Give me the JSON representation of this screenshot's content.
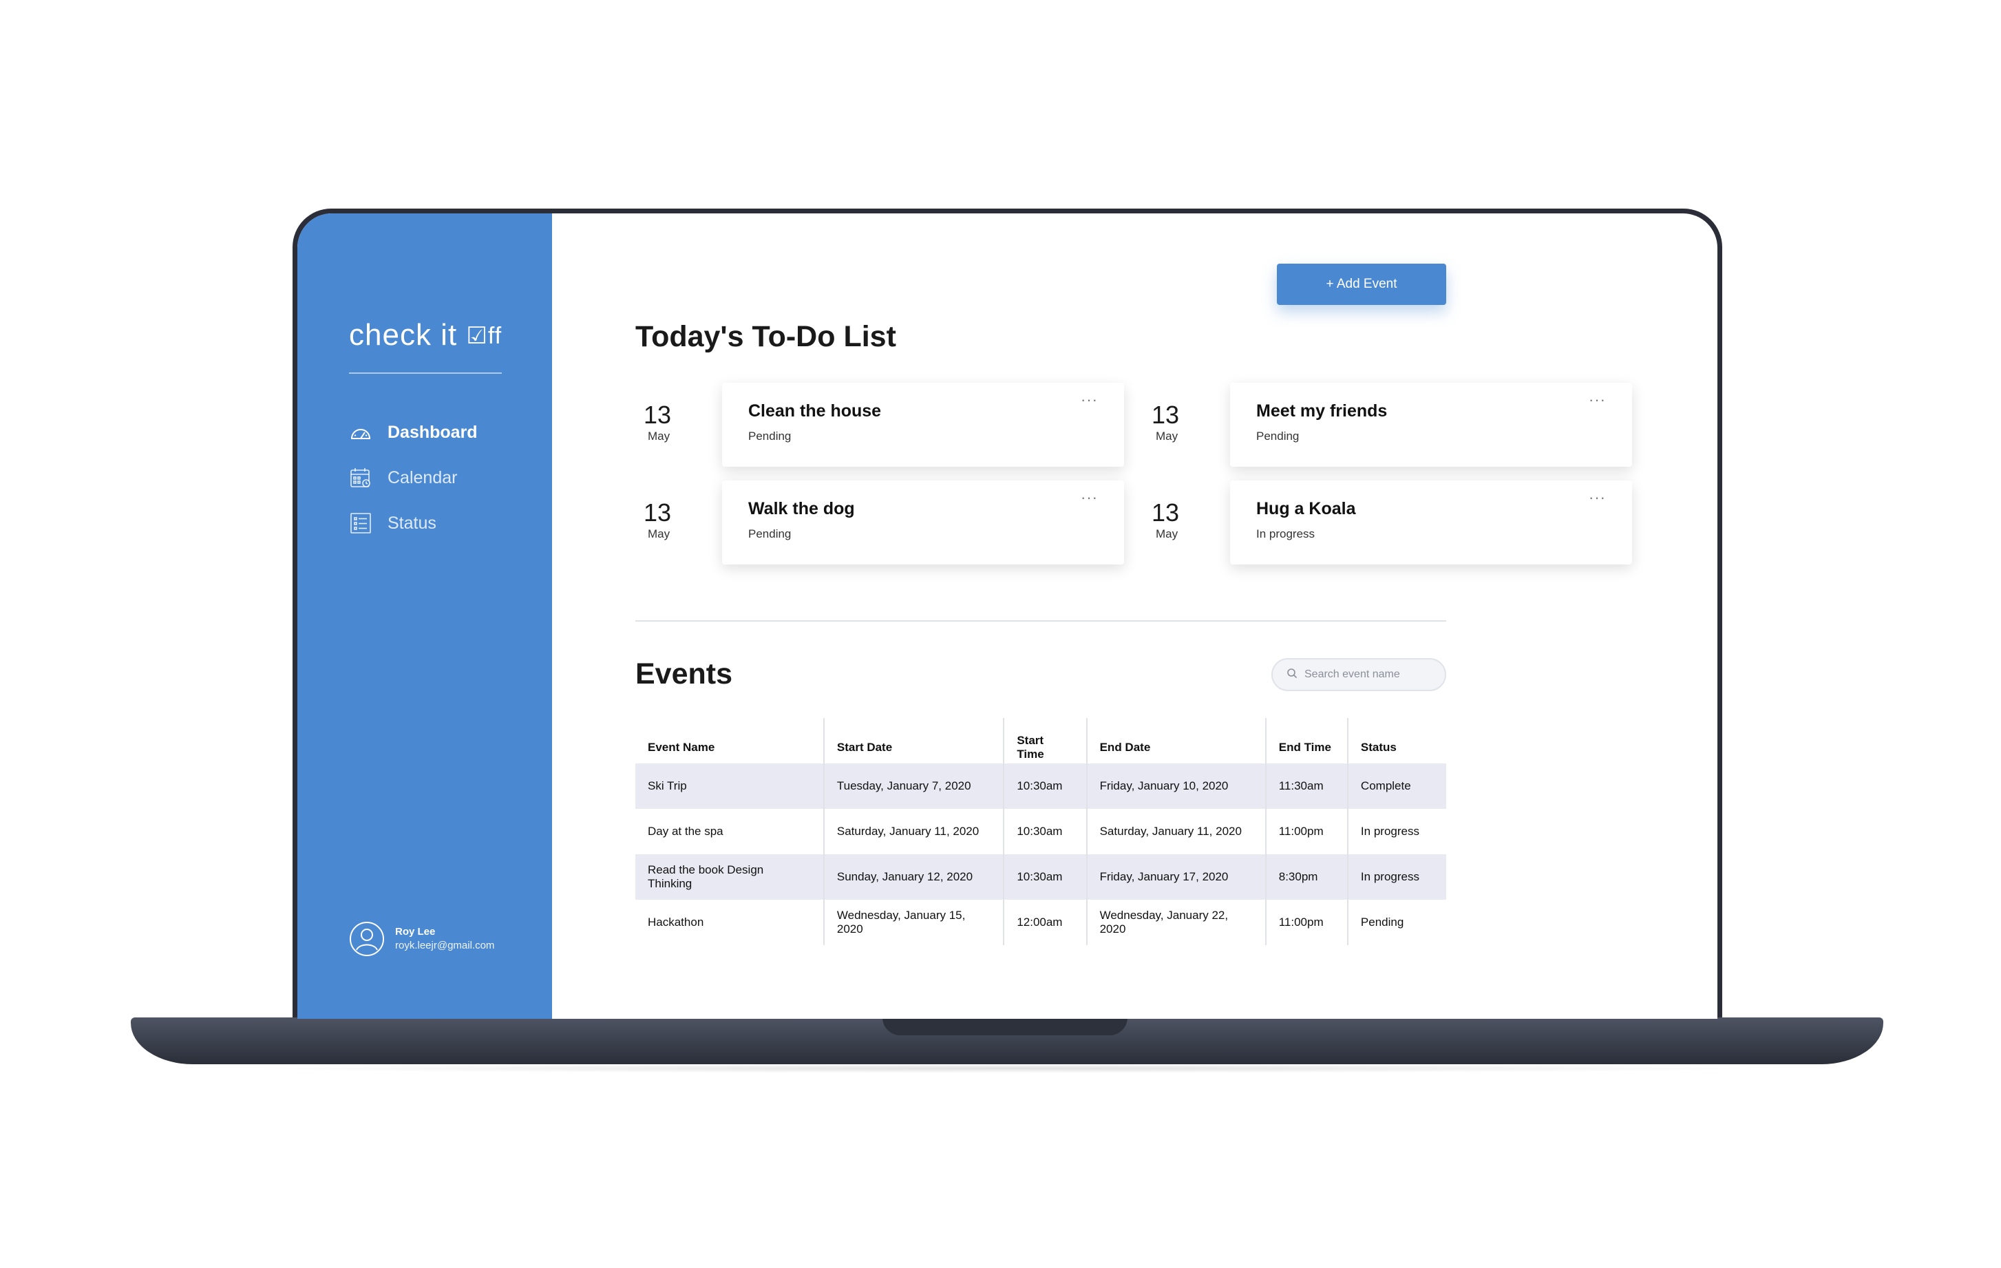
{
  "app": {
    "brand": "check it ",
    "brand_mark": "☑ff"
  },
  "sidebar": {
    "items": [
      {
        "label": "Dashboard",
        "icon": "dashboard-gauge-icon",
        "active": true
      },
      {
        "label": "Calendar",
        "icon": "calendar-icon",
        "active": false
      },
      {
        "label": "Status",
        "icon": "status-list-icon",
        "active": false
      }
    ],
    "user": {
      "name": "Roy Lee",
      "email": "royk.leejr@gmail.com",
      "icon": "user-avatar-icon"
    }
  },
  "header": {
    "add_button": "+ Add Event"
  },
  "todo": {
    "title": "Today's To-Do List",
    "more_label": "···",
    "items": [
      {
        "day": "13",
        "month": "May",
        "title": "Clean the house",
        "status": "Pending"
      },
      {
        "day": "13",
        "month": "May",
        "title": "Meet my friends",
        "status": "Pending"
      },
      {
        "day": "13",
        "month": "May",
        "title": "Walk the dog",
        "status": "Pending"
      },
      {
        "day": "13",
        "month": "May",
        "title": "Hug a Koala",
        "status": "In progress"
      }
    ]
  },
  "events": {
    "title": "Events",
    "search_placeholder": "Search event name",
    "columns": [
      "Event Name",
      "Start Date",
      "Start Time",
      "End Date",
      "End Time",
      "Status"
    ],
    "rows": [
      [
        "Ski Trip",
        "Tuesday, January 7, 2020",
        "10:30am",
        "Friday, January 10, 2020",
        "11:30am",
        "Complete"
      ],
      [
        "Day at the spa",
        "Saturday, January 11, 2020",
        "10:30am",
        "Saturday, January 11, 2020",
        "11:00pm",
        "In progress"
      ],
      [
        "Read the book Design Thinking",
        "Sunday, January 12, 2020",
        "10:30am",
        "Friday, January 17, 2020",
        "8:30pm",
        "In progress"
      ],
      [
        "Hackathon",
        "Wednesday, January 15, 2020",
        "12:00am",
        "Wednesday, January 22, 2020",
        "11:00pm",
        "Pending"
      ]
    ]
  },
  "colors": {
    "accent": "#4a89d2",
    "row_shade": "#e9e9f3",
    "laptop": "#2b2e38"
  }
}
